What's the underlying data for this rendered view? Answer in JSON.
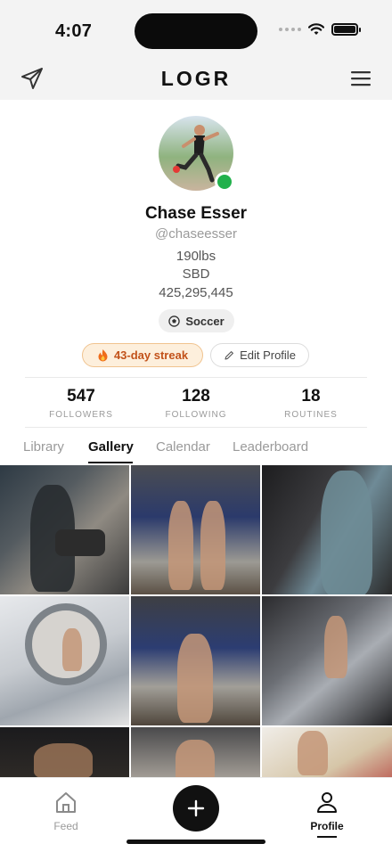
{
  "status_bar": {
    "time": "4:07"
  },
  "header": {
    "title": "LOGR",
    "left_icon": "send-icon",
    "right_icon": "menu-icon"
  },
  "profile": {
    "name": "Chase Esser",
    "handle": "@chaseesser",
    "weight": "190lbs",
    "sbd_label": "SBD",
    "sbd_value": "425,295,445",
    "sport": "Soccer",
    "streak": "43-day streak",
    "edit_label": "Edit Profile",
    "online": true
  },
  "stats": [
    {
      "value": "547",
      "label": "FOLLOWERS"
    },
    {
      "value": "128",
      "label": "FOLLOWING"
    },
    {
      "value": "18",
      "label": "ROUTINES"
    }
  ],
  "tabs": [
    {
      "label": "Library",
      "active": false
    },
    {
      "label": "Gallery",
      "active": true
    },
    {
      "label": "Calendar",
      "active": false
    },
    {
      "label": "Leaderboard",
      "active": false
    }
  ],
  "gallery_count": 9,
  "bottom_nav": {
    "feed_label": "Feed",
    "profile_label": "Profile",
    "add_icon": "plus-icon"
  },
  "colors": {
    "online": "#22b14c",
    "streak_text": "#c2521a",
    "streak_bg": "#fdefdc",
    "accent": "#111111"
  }
}
